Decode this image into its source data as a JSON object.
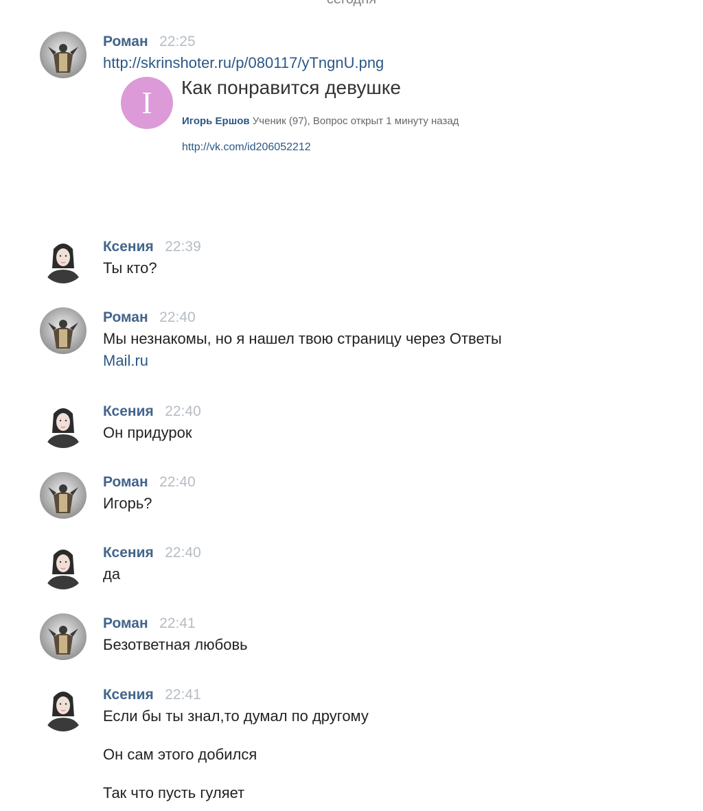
{
  "date_separator": "сегодня",
  "colors": {
    "author": "#42648b",
    "time": "#b6bcc4",
    "link": "#2a5885",
    "snippet_logo_bg": "#dc9ad8"
  },
  "messages": [
    {
      "author": "Роман",
      "time": "22:25",
      "lines": [
        "http://skrinshoter.ru/p/080117/yTngnU.png"
      ]
    },
    {
      "author": "Ксения",
      "time": "22:39",
      "lines": [
        "Ты кто?"
      ]
    },
    {
      "author": "Роман",
      "time": "22:40",
      "lines": [
        "Мы незнакомы, но я нашел твою страницу через Ответы"
      ],
      "link_line": "Mail.ru"
    },
    {
      "author": "Ксения",
      "time": "22:40",
      "lines": [
        "Он придурок"
      ]
    },
    {
      "author": "Роман",
      "time": "22:40",
      "lines": [
        "Игорь?"
      ]
    },
    {
      "author": "Ксения",
      "time": "22:40",
      "lines": [
        "да"
      ]
    },
    {
      "author": "Роман",
      "time": "22:41",
      "lines": [
        "Безответная любовь"
      ]
    },
    {
      "author": "Ксения",
      "time": "22:41",
      "lines": [
        "Если бы ты знал,то думал по другому",
        "Он сам этого добился",
        "Так что пусть гуляет"
      ]
    }
  ],
  "snippet": {
    "logo_letter": "I",
    "title": "Как понравится девушке",
    "author": "Игорь Ершов",
    "meta": "Ученик (97), Вопрос открыт 1 минуту назад",
    "url": "http://vk.com/id206052212"
  },
  "avatars": {
    "roman": "man-silhouette-avatar",
    "ksenia": "girl-portrait-avatar"
  }
}
